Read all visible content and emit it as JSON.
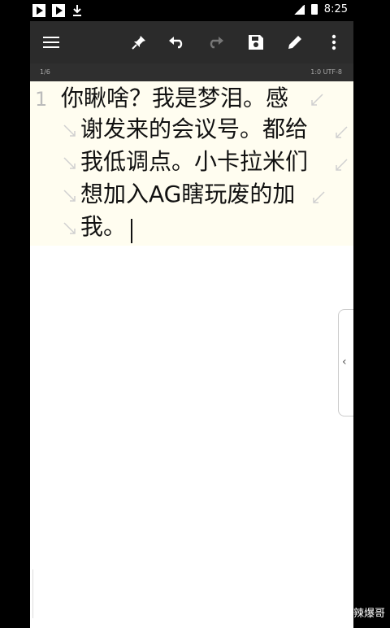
{
  "status_bar": {
    "time": "8:25",
    "icons": [
      "play-notification-icon",
      "play-notification-icon",
      "download-icon",
      "signal-icon",
      "battery-icon"
    ]
  },
  "toolbar": {
    "icons": [
      "menu-icon",
      "pin-icon",
      "undo-icon",
      "redo-icon",
      "save-icon",
      "edit-icon",
      "more-icon"
    ]
  },
  "ruler": {
    "left_text": "1/6",
    "right_text": "1:0 UTF-8"
  },
  "editor": {
    "line_number": "1",
    "lines": [
      "你瞅啥？我是梦泪。感",
      "谢发来的会议号。都给",
      "我低调点。小卡拉米们",
      "想加入AG瞎玩废的加",
      "我。"
    ]
  },
  "watermark": "头条 @麻辣爆哥",
  "colors": {
    "toolbar_bg": "#2b2b2b",
    "editor_bg": "#fffdf0",
    "status_bg": "#000000"
  }
}
